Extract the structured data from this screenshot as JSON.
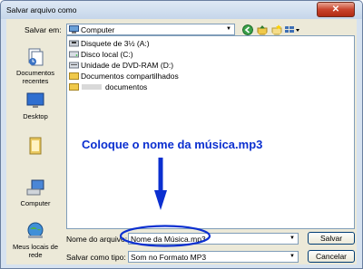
{
  "window": {
    "title": "Salvar arquivo como",
    "close_glyph": "✕"
  },
  "toolbar": {
    "save_in_label": "Salvar em:",
    "location": "Computer",
    "icons": [
      "back-icon",
      "up-folder-icon",
      "new-folder-icon",
      "view-menu-icon"
    ]
  },
  "places": [
    {
      "label": "Documentos recentes",
      "icon": "recent-documents-icon"
    },
    {
      "label": "Desktop",
      "icon": "desktop-icon"
    },
    {
      "label": "",
      "icon": "documents-folder-icon"
    },
    {
      "label": "Computer",
      "icon": "computer-icon"
    },
    {
      "label": "Meus locais de rede",
      "icon": "network-places-icon"
    }
  ],
  "files": [
    {
      "name": "Disquete de 3½ (A:)",
      "icon": "floppy-drive-icon"
    },
    {
      "name": "Disco local (C:)",
      "icon": "local-disk-icon"
    },
    {
      "name": "Unidade de DVD-RAM (D:)",
      "icon": "dvd-drive-icon"
    },
    {
      "name": "Documentos compartilhados",
      "icon": "shared-folder-icon"
    },
    {
      "name": "documentos",
      "icon": "user-folder-icon"
    }
  ],
  "annotation": {
    "text": "Coloque o nome da música.mp3",
    "color": "#0b2fd0"
  },
  "form": {
    "filename_label": "Nome do arquivo:",
    "filename_value": "Nome da Música.mp3",
    "filetype_label": "Salvar como tipo:",
    "filetype_value": "Som no Formato MP3"
  },
  "buttons": {
    "save": "Salvar",
    "cancel": "Cancelar"
  }
}
